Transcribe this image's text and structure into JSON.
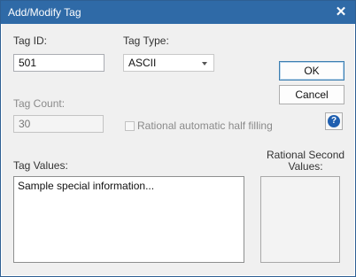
{
  "window": {
    "title": "Add/Modify Tag",
    "close_glyph": "✕"
  },
  "form": {
    "tag_id": {
      "label": "Tag ID:",
      "value": "501"
    },
    "tag_type": {
      "label": "Tag Type:",
      "value": "ASCII"
    },
    "tag_count": {
      "label": "Tag Count:",
      "value": "30"
    },
    "rational_fill": {
      "label": "Rational automatic half filling",
      "checked": false
    },
    "tag_values": {
      "label": "Tag Values:",
      "value": "Sample special information..."
    },
    "rational_second": {
      "label": "Rational Second\nValues:"
    }
  },
  "buttons": {
    "ok": "OK",
    "cancel": "Cancel",
    "help_glyph": "?"
  }
}
